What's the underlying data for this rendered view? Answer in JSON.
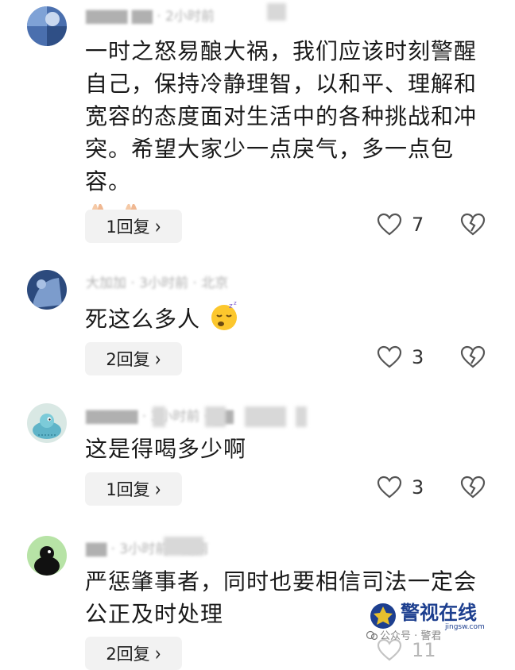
{
  "comments": [
    {
      "meta": "▇▇▇▇ ▇▇ · 2小时前",
      "lines": [
        "一时之怒易酿大祸，我们应该时刻警醒",
        "自己，保持冷静理智，以和平、理解和",
        "宽容的态度面对生活中的各种挑战和冲",
        "突。希望大家少一点戾气，多一点包容。"
      ],
      "emoji": "praying-hands-emoji",
      "reply_label": "1回复",
      "like_count": "7"
    },
    {
      "meta": "大加加 · 3小时前 · 北京",
      "lines": [
        "死这么多人"
      ],
      "emoji": "sleepy-face-emoji",
      "reply_label": "2回复",
      "like_count": "3"
    },
    {
      "meta": "▇▇▇▇▇ · 3小时前 · ▇▇",
      "lines": [
        "这是得喝多少啊"
      ],
      "reply_label": "1回复",
      "like_count": "3"
    },
    {
      "meta": "▇▇ · 3小时前 · 湖南",
      "lines": [
        "严惩肇事者，同时也要相信司法一定会",
        "公正及时处理"
      ],
      "reply_label": "2回复",
      "like_count": "11"
    }
  ],
  "watermark": {
    "brand": "警视在线",
    "domain": "jingsw.com",
    "account": "公众号 · 警君"
  },
  "colors": {
    "button_bg": "#f2f2f2",
    "meta_gray": "#b0b0b0",
    "icon_gray": "#555555"
  }
}
